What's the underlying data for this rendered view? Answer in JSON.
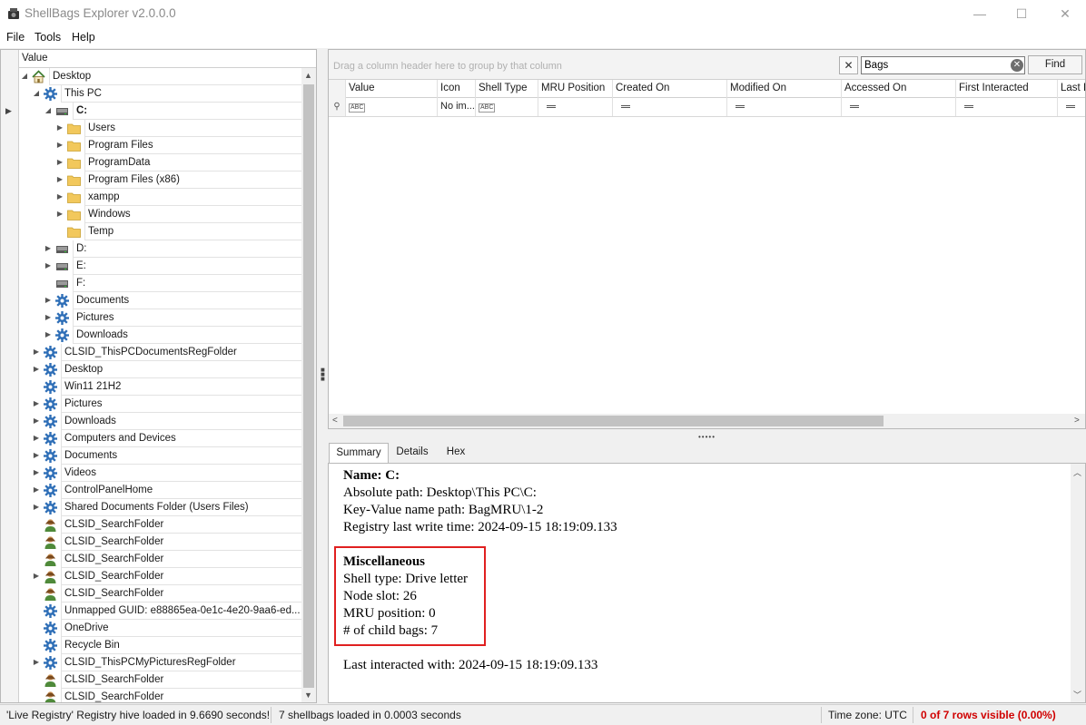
{
  "window": {
    "title": "ShellBags Explorer v2.0.0.0",
    "minimize": "—",
    "maximize": "☐",
    "close": "✕"
  },
  "menu": {
    "items": [
      "File",
      "Tools",
      "Help"
    ]
  },
  "tree": {
    "header": "Value",
    "rows": [
      {
        "label": "Desktop",
        "icon": "home-icon",
        "expander": "collapse"
      },
      {
        "label": "This PC",
        "icon": "gear-icon",
        "expander": "collapse"
      },
      {
        "label": "C:",
        "icon": "drive-icon",
        "expander": "collapse",
        "selected": true
      },
      {
        "label": "Users",
        "icon": "folder-icon",
        "expander": "expand"
      },
      {
        "label": "Program Files",
        "icon": "folder-icon",
        "expander": "expand"
      },
      {
        "label": "ProgramData",
        "icon": "folder-icon",
        "expander": "expand"
      },
      {
        "label": "Program Files (x86)",
        "icon": "folder-icon",
        "expander": "expand"
      },
      {
        "label": "xampp",
        "icon": "folder-icon",
        "expander": "expand"
      },
      {
        "label": "Windows",
        "icon": "folder-icon",
        "expander": "expand"
      },
      {
        "label": "Temp",
        "icon": "folder-icon",
        "expander": "none"
      },
      {
        "label": "D:",
        "icon": "drive-icon",
        "expander": "expand"
      },
      {
        "label": "E:",
        "icon": "drive-icon",
        "expander": "expand"
      },
      {
        "label": "F:",
        "icon": "drive-icon",
        "expander": "none"
      },
      {
        "label": "Documents",
        "icon": "gear-icon",
        "expander": "expand"
      },
      {
        "label": "Pictures",
        "icon": "gear-icon",
        "expander": "expand"
      },
      {
        "label": "Downloads",
        "icon": "gear-icon",
        "expander": "expand"
      },
      {
        "label": "CLSID_ThisPCDocumentsRegFolder",
        "icon": "gear-icon",
        "expander": "expand"
      },
      {
        "label": "Desktop",
        "icon": "gear-icon",
        "expander": "expand"
      },
      {
        "label": "Win11 21H2",
        "icon": "gear-icon",
        "expander": "none"
      },
      {
        "label": "Pictures",
        "icon": "gear-icon",
        "expander": "expand"
      },
      {
        "label": "Downloads",
        "icon": "gear-icon",
        "expander": "expand"
      },
      {
        "label": "Computers and Devices",
        "icon": "gear-icon",
        "expander": "expand"
      },
      {
        "label": "Documents",
        "icon": "gear-icon",
        "expander": "expand"
      },
      {
        "label": "Videos",
        "icon": "gear-icon",
        "expander": "expand"
      },
      {
        "label": "ControlPanelHome",
        "icon": "gear-icon",
        "expander": "expand"
      },
      {
        "label": "Shared Documents Folder (Users Files)",
        "icon": "gear-icon",
        "expander": "expand"
      },
      {
        "label": "CLSID_SearchFolder",
        "icon": "user-icon",
        "expander": "none"
      },
      {
        "label": "CLSID_SearchFolder",
        "icon": "user-icon",
        "expander": "none"
      },
      {
        "label": "CLSID_SearchFolder",
        "icon": "user-icon",
        "expander": "none"
      },
      {
        "label": "CLSID_SearchFolder",
        "icon": "user-icon",
        "expander": "expand"
      },
      {
        "label": "CLSID_SearchFolder",
        "icon": "user-icon",
        "expander": "none"
      },
      {
        "label": "Unmapped GUID: e88865ea-0e1c-4e20-9aa6-ed...",
        "icon": "gear-icon",
        "expander": "none"
      },
      {
        "label": "OneDrive",
        "icon": "gear-icon",
        "expander": "none"
      },
      {
        "label": "Recycle Bin",
        "icon": "gear-icon",
        "expander": "none"
      },
      {
        "label": "CLSID_ThisPCMyPicturesRegFolder",
        "icon": "gear-icon",
        "expander": "expand"
      },
      {
        "label": "CLSID_SearchFolder",
        "icon": "user-icon",
        "expander": "none"
      },
      {
        "label": "CLSID_SearchFolder",
        "icon": "user-icon",
        "expander": "none"
      }
    ]
  },
  "grid": {
    "group_hint": "Drag a column header here to group by that column",
    "search_value": "Bags",
    "find_label": "Find",
    "columns": [
      "Value",
      "Icon",
      "Shell Type",
      "MRU Position",
      "Created On",
      "Modified On",
      "Accessed On",
      "First Interacted",
      "Last I"
    ],
    "filter_icon_text": "No im..."
  },
  "details": {
    "tabs": [
      "Summary",
      "Details",
      "Hex"
    ],
    "name_line": "Name: C:",
    "absolute_path": "Absolute path: Desktop\\This PC\\C:",
    "key_value_path": "Key-Value name path: BagMRU\\1-2",
    "registry_write": "Registry last write time: 2024-09-15 18:19:09.133",
    "misc_heading": "Miscellaneous",
    "shell_type": "Shell type: Drive letter",
    "node_slot": "Node slot: 26",
    "mru_position": "MRU position: 0",
    "child_bags": "# of child bags: 7",
    "last_interacted": "Last interacted with: 2024-09-15 18:19:09.133"
  },
  "status": {
    "hive_loaded": "'Live Registry' Registry hive loaded in 9.6690 seconds!",
    "shellbags_loaded": "7 shellbags loaded in 0.0003 seconds",
    "timezone": "Time zone: UTC",
    "rows_visible": "0 of 7 rows visible (0.00%)"
  },
  "colors": {
    "highlight_border": "#e02020",
    "rows_visible_text": "#d00000",
    "folder": "#f2c85c",
    "gear": "#2f6fb7"
  }
}
